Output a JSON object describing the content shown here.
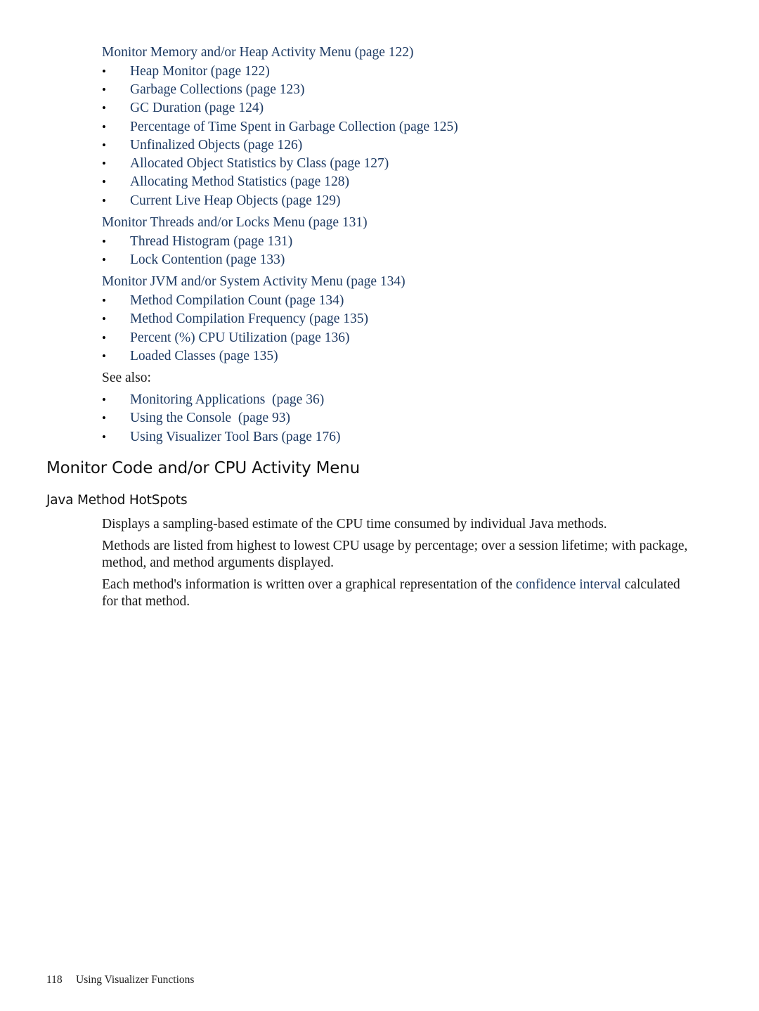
{
  "groups": [
    {
      "title": "Monitor Memory and/or Heap Activity Menu (page 122)",
      "items": [
        "Heap Monitor (page 122)",
        "Garbage Collections (page 123)",
        "GC Duration (page 124)",
        "Percentage of Time Spent in Garbage Collection (page 125)",
        "Unfinalized Objects (page 126)",
        "Allocated Object Statistics by Class (page 127)",
        "Allocating Method Statistics (page 128)",
        "Current Live Heap Objects (page 129)"
      ]
    },
    {
      "title": "Monitor Threads and/or Locks Menu (page 131)",
      "items": [
        "Thread Histogram (page 131)",
        "Lock Contention (page 133)"
      ]
    },
    {
      "title": "Monitor JVM and/or System Activity Menu (page 134)",
      "items": [
        "Method Compilation Count (page 134)",
        "Method Compilation Frequency (page 135)",
        "Percent (%) CPU Utilization (page 136)",
        "Loaded Classes (page 135)"
      ]
    }
  ],
  "see_also": {
    "label": "See also:",
    "items": [
      "Monitoring Applications  (page 36)",
      "Using the Console  (page 93)",
      "Using Visualizer Tool Bars (page 176)"
    ]
  },
  "bullet": "•",
  "section": {
    "heading": "Monitor Code and/or CPU Activity Menu",
    "subheading": "Java Method HotSpots",
    "paragraphs": {
      "p1": "Displays a sampling-based estimate of the CPU time consumed by individual Java methods.",
      "p2": "Methods are listed from highest to lowest CPU usage by percentage; over a session lifetime; with package, method, and method arguments displayed.",
      "p3_before": "Each method's information is written over a graphical representation of the ",
      "p3_link": "confidence interval",
      "p3_after": " calculated for that method."
    }
  },
  "footer": {
    "page_number": "118",
    "chapter": "Using Visualizer Functions"
  },
  "colors": {
    "link": "#1d3a63",
    "text": "#1a1a1a"
  }
}
